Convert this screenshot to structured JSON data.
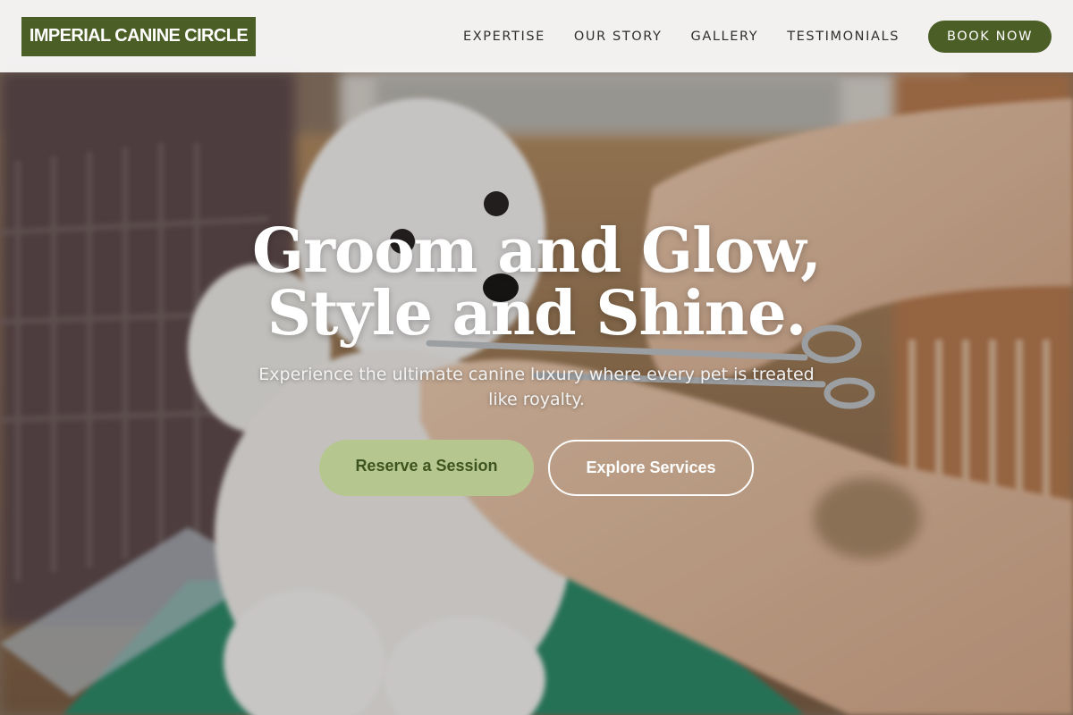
{
  "brand": {
    "name": "IMPERIAL CANINE CIRCLE",
    "color": "#4a5e25"
  },
  "nav": {
    "links": [
      {
        "label": "EXPERTISE"
      },
      {
        "label": "OUR STORY"
      },
      {
        "label": "GALLERY"
      },
      {
        "label": "TESTIMONIALS"
      }
    ],
    "cta_label": "BOOK NOW"
  },
  "hero": {
    "headline_line1": "Groom and Glow,",
    "headline_line2": "Style and Shine.",
    "subtitle": "Experience the ultimate canine luxury where every pet is treated like royalty.",
    "primary_button": "Reserve a Session",
    "secondary_button": "Explore Services",
    "primary_button_color": "#b5c78f"
  }
}
